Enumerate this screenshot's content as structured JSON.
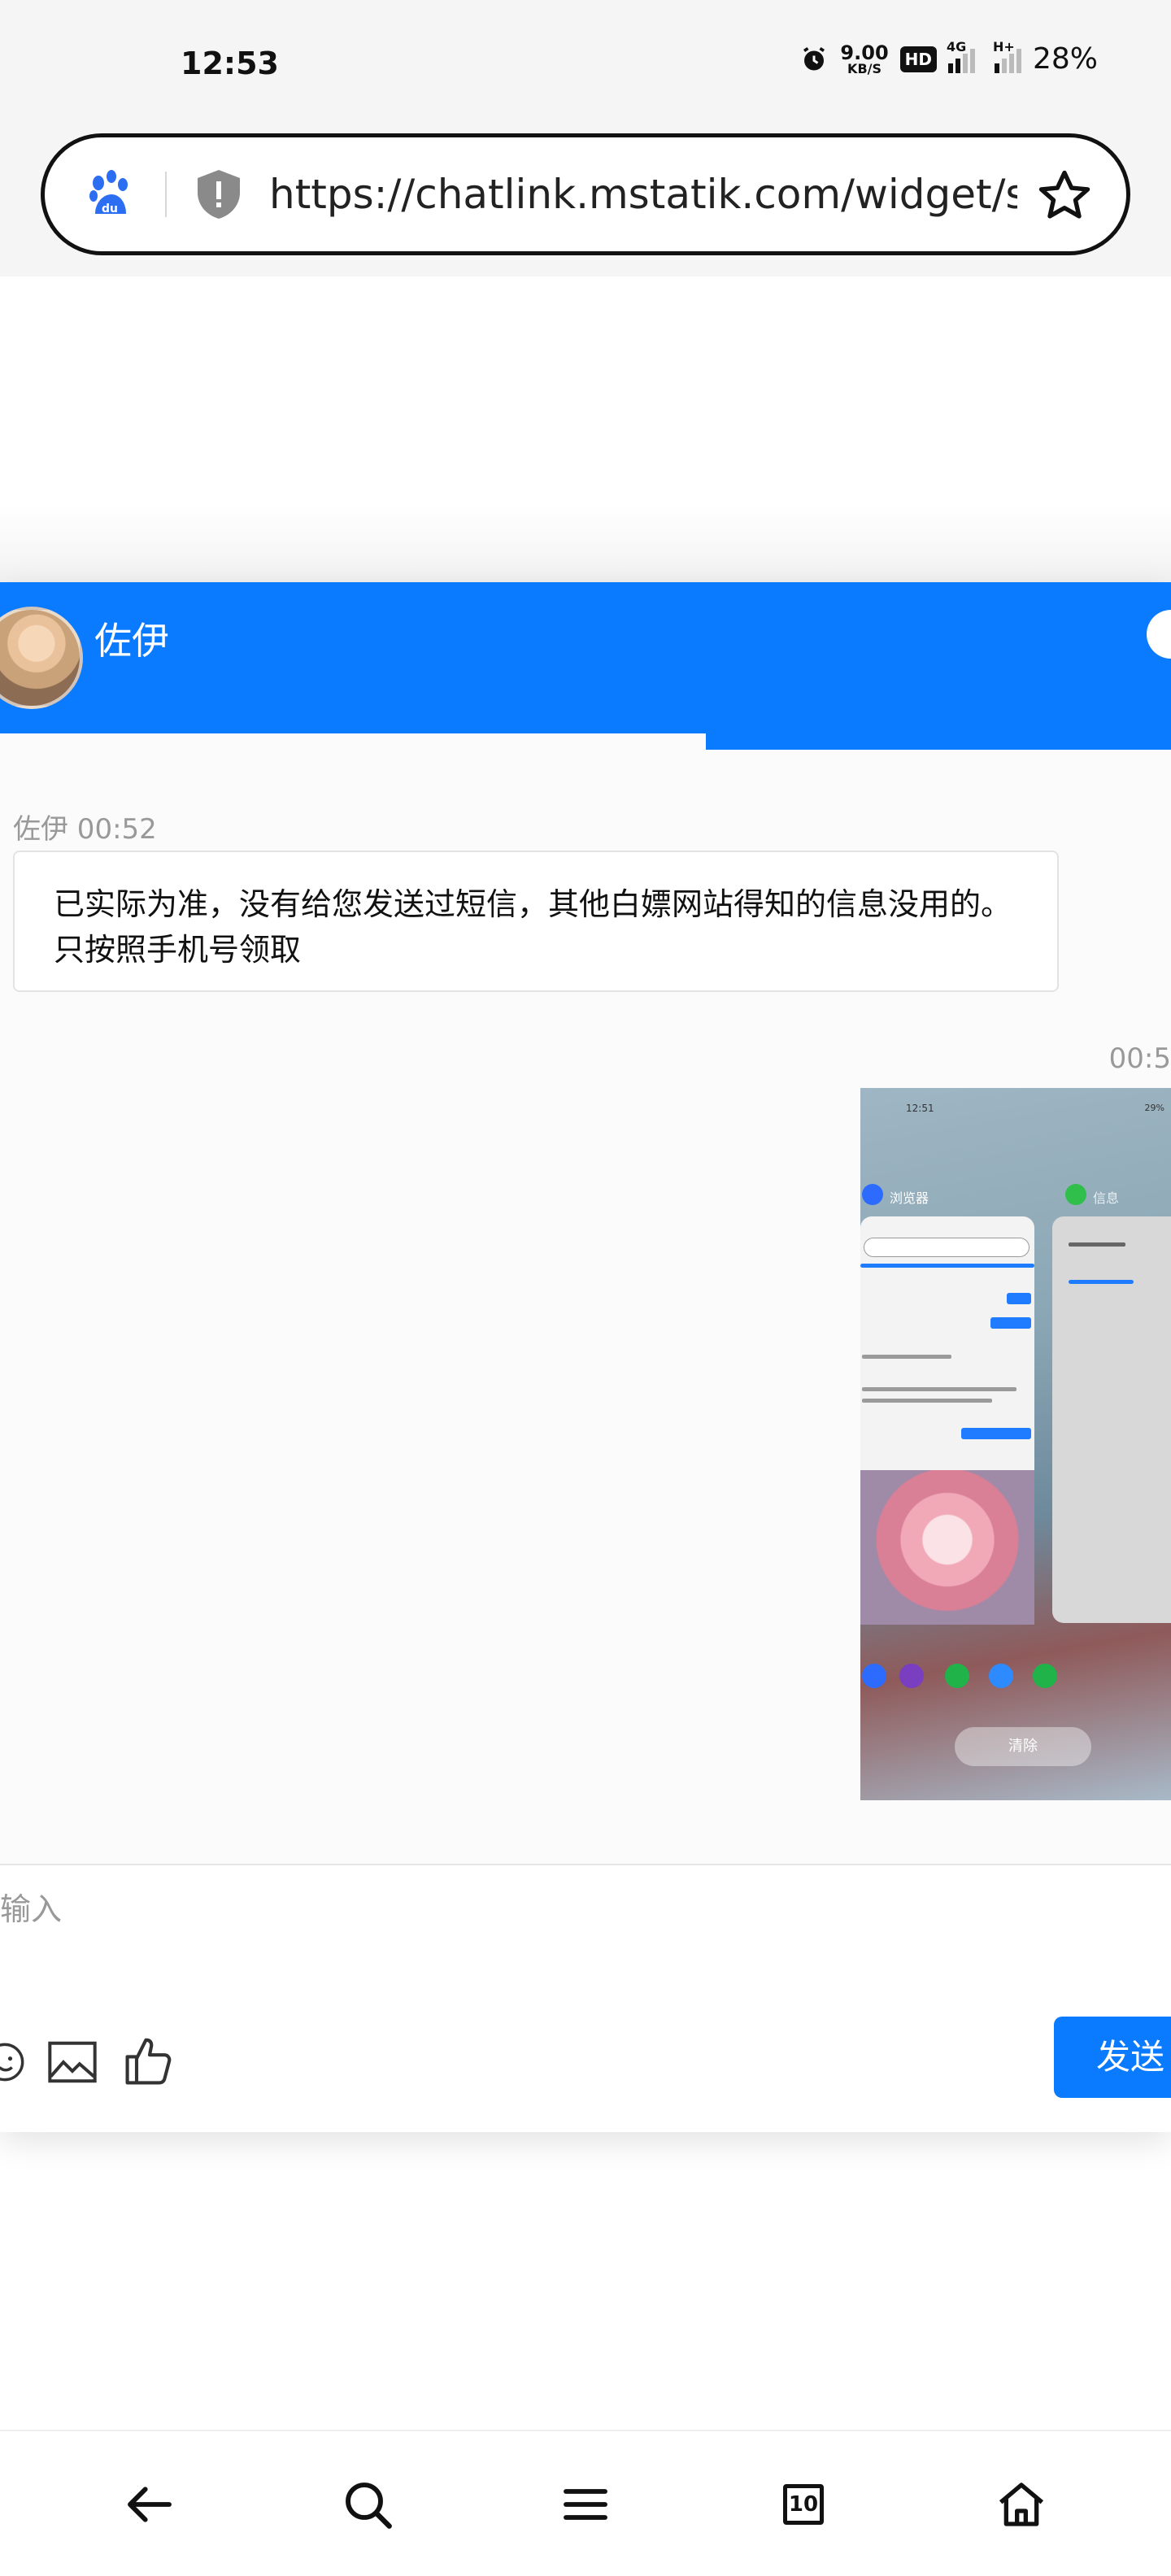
{
  "status_bar": {
    "time": "12:53",
    "net_speed_value": "9.00",
    "net_speed_unit": "KB/S",
    "hd": "HD",
    "signal1_label": "4G",
    "signal2_label": "H+",
    "battery": "28%"
  },
  "browser": {
    "url": "https://chatlink.mstatik.com/widget/st..."
  },
  "chat": {
    "agent_name": "佐伊",
    "messages": [
      {
        "meta": "佐伊 00:52",
        "text": "已实际为准，没有给您发送过短信，其他白嫖网站得知的信息没用的。只按照手机号领取"
      },
      {
        "time": "00:5"
      }
    ],
    "screenshot": {
      "time": "12:51",
      "status": "29%",
      "app1_label": "浏览器",
      "app2_label": "信息",
      "clear_label": "清除"
    },
    "input_placeholder": "输入",
    "send_label": "发送"
  },
  "bottom_nav": {
    "tab_count": "10"
  },
  "colors": {
    "accent": "#0a7aff",
    "status_bar_bg": "#f5f5f5"
  }
}
